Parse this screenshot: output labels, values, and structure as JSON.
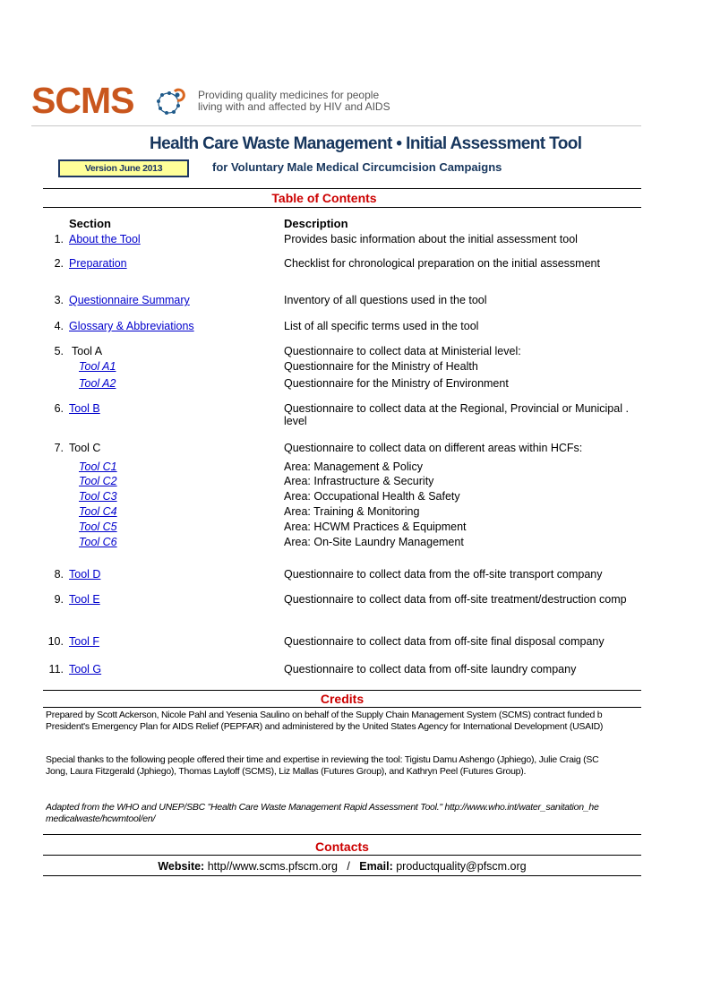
{
  "header": {
    "logo_text": "SCMS",
    "tagline_line1": "Providing quality medicines for people",
    "tagline_line2": "living with and affected by HIV and AIDS",
    "title": "Health Care Waste Management • Initial Assessment Tool",
    "subtitle": "for Voluntary Male Medical Circumcision Campaigns",
    "version": "Version June 2013"
  },
  "toc": {
    "heading": "Table of Contents",
    "col_section": "Section",
    "col_description": "Description",
    "items": [
      {
        "num": "1.",
        "label": "About the Tool",
        "link": true,
        "desc": "Provides basic information about the initial assessment tool"
      },
      {
        "num": "2.",
        "label": "Preparation",
        "link": true,
        "desc": "Checklist for chronological preparation on the initial assessment"
      },
      {
        "num": "3.",
        "label": "Questionnaire Summary",
        "link": true,
        "desc": "Inventory of all questions used in the tool"
      },
      {
        "num": "4.",
        "label": "Glossary & Abbreviations",
        "link": true,
        "desc": "List of all specific terms used in the tool"
      },
      {
        "num": "5.",
        "label": "Tool A",
        "link": false,
        "desc": "Questionnaire to collect data at Ministerial level:",
        "subitems": [
          {
            "label": "Tool A1",
            "desc": "Questionnaire for the Ministry of Health"
          },
          {
            "label": "Tool A2",
            "desc": "Questionnaire for the Ministry of Environment"
          }
        ]
      },
      {
        "num": "6.",
        "label": "Tool B",
        "link": true,
        "desc": "Questionnaire to collect data at the Regional, Provincial or Municipal .",
        "desc2": "level"
      },
      {
        "num": "7.",
        "label": "Tool C",
        "link": false,
        "desc": "Questionnaire to collect data on different areas within HCFs:",
        "subitems": [
          {
            "label": "Tool C1",
            "desc": "Area: Management & Policy"
          },
          {
            "label": "Tool C2",
            "desc": "Area: Infrastructure & Security"
          },
          {
            "label": "Tool C3",
            "desc": "Area: Occupational Health & Safety"
          },
          {
            "label": "Tool C4",
            "desc": "Area: Training & Monitoring"
          },
          {
            "label": "Tool C5",
            "desc": "Area: HCWM Practices & Equipment"
          },
          {
            "label": "Tool C6",
            "desc": "Area: On-Site Laundry Management"
          }
        ]
      },
      {
        "num": "8.",
        "label": "Tool D",
        "link": true,
        "desc": "Questionnaire to collect data from the off-site transport company"
      },
      {
        "num": "9.",
        "label": "Tool E",
        "link": true,
        "desc": "Questionnaire to collect data from off-site treatment/destruction comp"
      },
      {
        "num": "10.",
        "label": "Tool F",
        "link": true,
        "desc": "Questionnaire to collect data from off-site final disposal company"
      },
      {
        "num": "11.",
        "label": "Tool G",
        "link": true,
        "desc": "Questionnaire to collect data from off-site laundry company"
      }
    ]
  },
  "credits": {
    "heading": "Credits",
    "prepared_line1": "Prepared by Scott Ackerson, Nicole Pahl and Yesenia Saulino on behalf of the Supply Chain Management System (SCMS) contract funded b",
    "prepared_line2": "President's Emergency Plan for AIDS Relief (PEPFAR) and administered by the United States Agency for International Development (USAID)",
    "thanks_line1": "Special thanks to the following people offered their time and expertise in reviewing the tool: Tigistu Damu Ashengo (Jphiego), Julie Craig (SC",
    "thanks_line2": "Jong, Laura Fitzgerald (Jphiego), Thomas Layloff (SCMS), Liz Mallas (Futures Group), and Kathryn Peel (Futures Group).",
    "adapted_line1": "Adapted from the WHO and UNEP/SBC \"Health Care Waste Management Rapid Assessment Tool.\" http://www.who.int/water_sanitation_he",
    "adapted_line2": "medicalwaste/hcwmtool/en/"
  },
  "contacts": {
    "heading": "Contacts",
    "website_label": "Website:",
    "website_value": "http//www.scms.pfscm.org",
    "separator": "/",
    "email_label": "Email:",
    "email_value": "productquality@pfscm.org"
  },
  "colors": {
    "brand_orange": "#c9561d",
    "title_navy": "#17365d",
    "section_red": "#cc0000",
    "link_blue": "#0000cc",
    "version_fill": "#ffff99"
  }
}
